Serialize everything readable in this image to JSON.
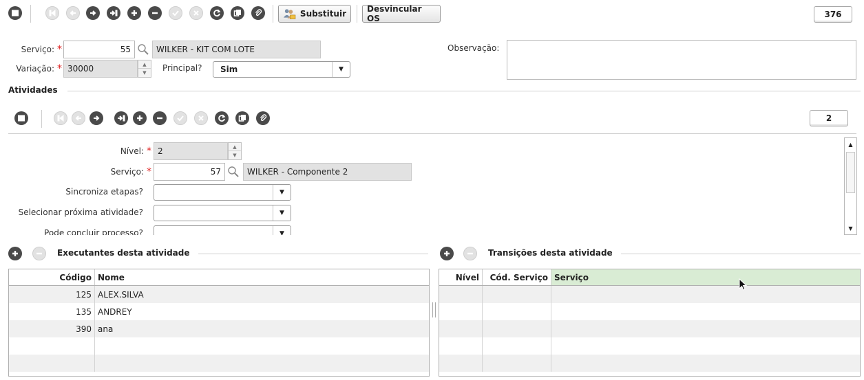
{
  "toolbar": {
    "substituir_label": "Substituir",
    "desvincular_label": "Desvincular OS",
    "record_counter": "376"
  },
  "form": {
    "servico_label": "Serviço:",
    "servico_code": "55",
    "servico_desc": "WILKER - KIT COM LOTE",
    "variacao_label": "Variação:",
    "variacao_value": "30000",
    "principal_label": "Principal?",
    "principal_value": "Sim",
    "observacao_label": "Observação:"
  },
  "atividades": {
    "title": "Atividades",
    "record_counter": "2",
    "nivel_label": "Nível:",
    "nivel_value": "2",
    "servico_label": "Serviço:",
    "servico_code": "57",
    "servico_desc": "WILKER - Componente 2",
    "sincroniza_label": "Sincroniza etapas?",
    "selecionar_label": "Selecionar próxima atividade?",
    "pode_concluir_label": "Pode concluir processo?"
  },
  "executantes": {
    "title": "Executantes desta atividade",
    "columns": [
      "Código",
      "Nome"
    ],
    "rows": [
      {
        "codigo": "125",
        "nome": "ALEX.SILVA"
      },
      {
        "codigo": "135",
        "nome": "ANDREY"
      },
      {
        "codigo": "390",
        "nome": "ana"
      }
    ]
  },
  "transicoes": {
    "title": "Transições desta atividade",
    "columns": [
      "Nível",
      "Cód. Serviço",
      "Serviço"
    ]
  },
  "colors": {
    "required": "#e02020",
    "selected_header": "#d9ecd4",
    "readonly_bg": "#e2e2e2"
  }
}
